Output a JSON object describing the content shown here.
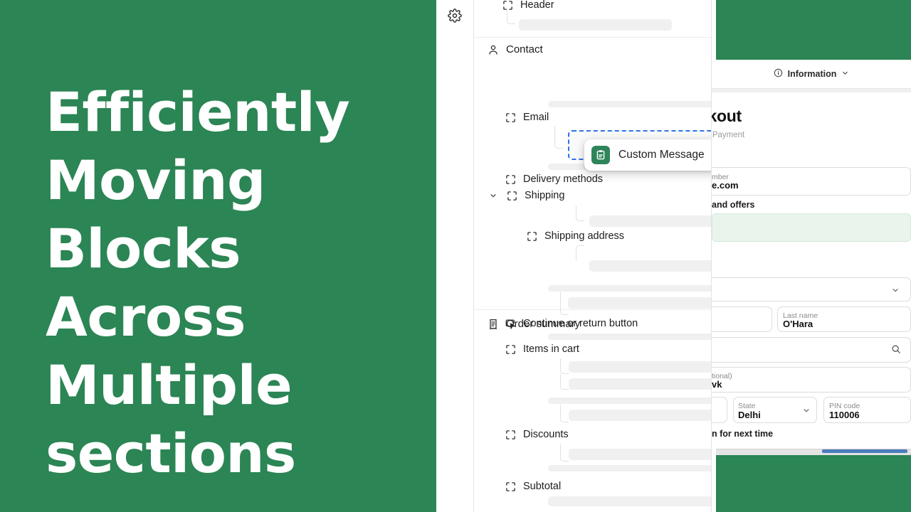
{
  "title_panel": {
    "headline": "Efficiently Moving Blocks Across Multiple sections",
    "bg_color": "#2b8554",
    "text_color": "#ffffff"
  },
  "editor": {
    "gear_icon": "gear-icon",
    "drag_chip": {
      "label": "Custom Message",
      "icon": "clipboard-icon",
      "icon_bg": "#2f855a"
    },
    "drop_target_color": "#2f72e8",
    "sections": [
      {
        "name": "header-section",
        "nodes": [
          {
            "label": "Header",
            "icon": "square-icon",
            "indent": 0,
            "clipped": true
          }
        ]
      },
      {
        "name": "contact-section",
        "nodes": [
          {
            "label": "Contact",
            "icon": "person-icon",
            "indent": 0
          },
          {
            "label": "Email",
            "icon": "block-icon",
            "indent": 1
          },
          {
            "label": "Delivery methods",
            "icon": "block-icon",
            "indent": 1
          },
          {
            "label": "Shipping",
            "icon": "block-icon",
            "indent": 1,
            "chevron": "chevron-down-icon"
          },
          {
            "label": "Shipping address",
            "icon": "block-icon",
            "indent": 2
          },
          {
            "label": "Continue or return button",
            "icon": "cursor-button-icon",
            "indent": 1
          }
        ]
      },
      {
        "name": "order-summary-section",
        "nodes": [
          {
            "label": "Order summary",
            "icon": "receipt-icon",
            "indent": 0
          },
          {
            "label": "Items in cart",
            "icon": "block-icon",
            "indent": 1
          },
          {
            "label": "Discounts",
            "icon": "block-icon",
            "indent": 1
          },
          {
            "label": "Subtotal",
            "icon": "block-icon",
            "indent": 1
          }
        ]
      }
    ]
  },
  "preview": {
    "banner_color": "#2b8554",
    "information_label": "Information",
    "information_icon": "info-icon",
    "information_chevron": "chevron-down-icon",
    "page_title": "ckout",
    "breadcrumb": "Payment",
    "contact_field": {
      "label": "mber",
      "value": "e.com"
    },
    "offers_text": "and offers",
    "green_note_box": "",
    "last_name": {
      "label": "Last name",
      "value": "O'Hara"
    },
    "address_optional": {
      "label": "tional)",
      "value": "vk"
    },
    "state": {
      "label": "State",
      "value": "Delhi"
    },
    "pin_code": {
      "label": "PIN code",
      "value": "110006"
    },
    "save_info_text": "n for next time",
    "search_icon": "search-icon",
    "scrollbar_thumb_color": "#4a7ebb"
  }
}
